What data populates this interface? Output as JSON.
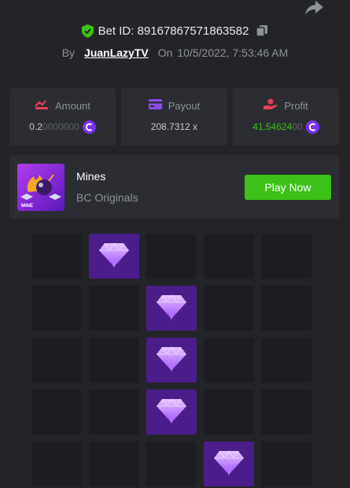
{
  "bet": {
    "id_label": "Bet ID: 89167867571863582",
    "by_label": "By",
    "username": "JuanLazyTV",
    "on_label": "On",
    "timestamp": "10/5/2022, 7:53:46 AM"
  },
  "stats": {
    "amount": {
      "label": "Amount",
      "value_main": "0.2",
      "value_dim": "0000000"
    },
    "payout": {
      "label": "Payout",
      "value": "208.7312 x"
    },
    "profit": {
      "label": "Profit",
      "value_main": "41.54624",
      "value_dim": "00"
    }
  },
  "game": {
    "title": "Mines",
    "provider": "BC Originals",
    "thumb_badge": "MINE",
    "play_label": "Play Now"
  },
  "board": {
    "rows": 5,
    "cols": 5,
    "gems": [
      1,
      7,
      12,
      17,
      23
    ]
  },
  "colors": {
    "accent_green": "#3bc117",
    "gem_tile": "#4a1d8a",
    "coin": "#7b2ff7"
  },
  "icons": {
    "share": "share-icon",
    "verified": "shield-check-icon",
    "copy": "copy-icon",
    "amount": "bet-amount-icon",
    "payout": "payout-card-icon",
    "profit": "profit-icon",
    "coin": "coin-icon",
    "gem": "diamond-icon"
  }
}
